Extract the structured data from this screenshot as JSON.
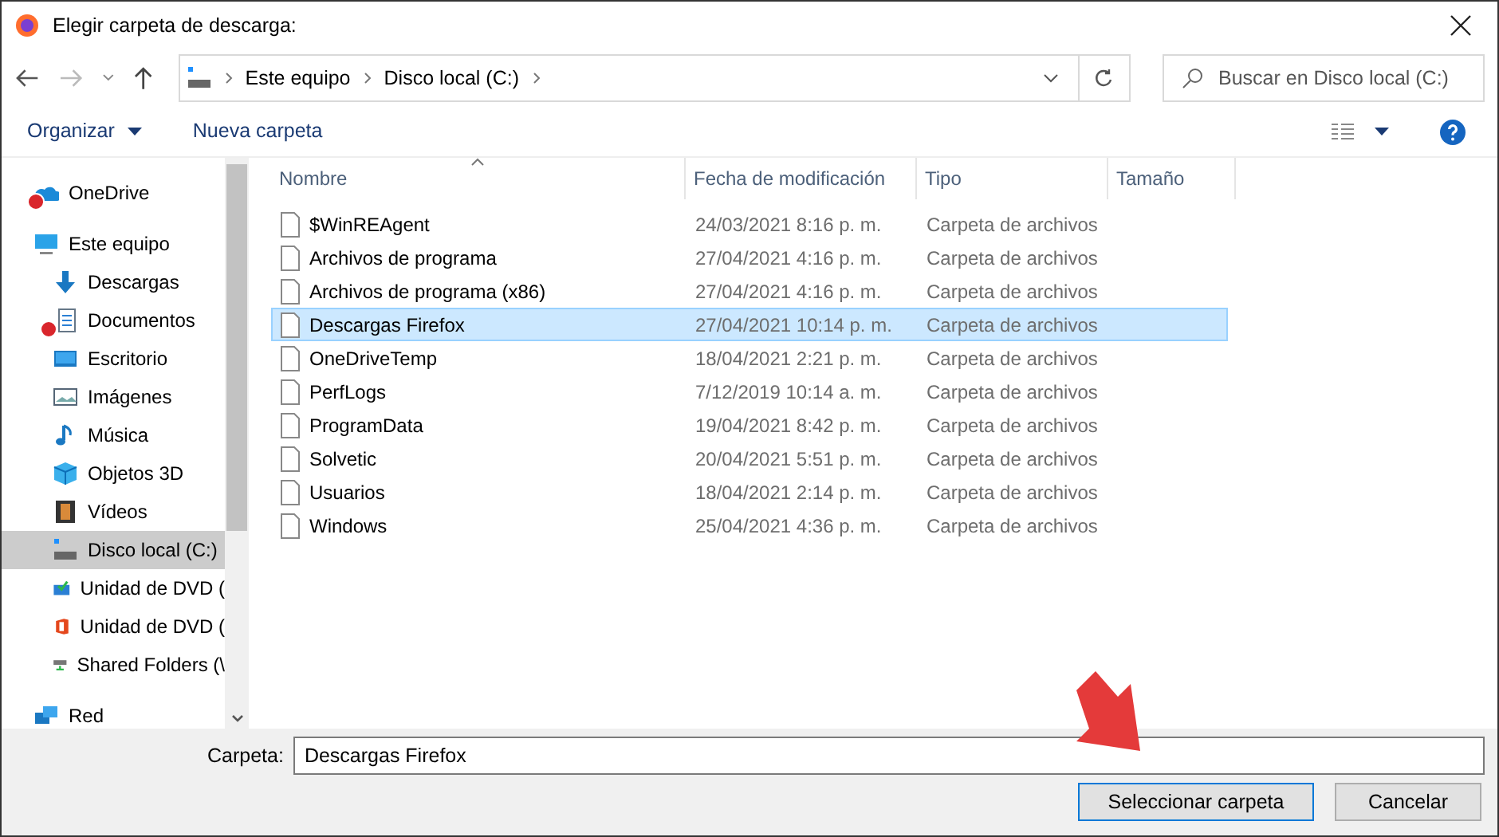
{
  "window": {
    "title": "Elegir carpeta de descarga:"
  },
  "address_bar": {
    "crumbs": [
      "Este equipo",
      "Disco local (C:)"
    ]
  },
  "search": {
    "placeholder": "Buscar en Disco local (C:)"
  },
  "toolbar": {
    "organize": "Organizar",
    "new_folder": "Nueva carpeta"
  },
  "sidebar": {
    "items": [
      {
        "label": "OneDrive",
        "kind": "cloud",
        "error": true,
        "selected": false
      },
      {
        "label": "Este equipo",
        "kind": "pc",
        "error": false,
        "selected": false,
        "children": [
          {
            "label": "Descargas",
            "kind": "download",
            "error": false,
            "selected": false
          },
          {
            "label": "Documentos",
            "kind": "docs",
            "error": true,
            "selected": false
          },
          {
            "label": "Escritorio",
            "kind": "desktop",
            "error": false,
            "selected": false
          },
          {
            "label": "Imágenes",
            "kind": "images",
            "error": false,
            "selected": false
          },
          {
            "label": "Música",
            "kind": "music",
            "error": false,
            "selected": false
          },
          {
            "label": "Objetos 3D",
            "kind": "cube",
            "error": false,
            "selected": false
          },
          {
            "label": "Vídeos",
            "kind": "film",
            "error": false,
            "selected": false
          },
          {
            "label": "Disco local (C:)",
            "kind": "drive",
            "error": false,
            "selected": true
          },
          {
            "label": "Unidad de DVD (",
            "kind": "dvd",
            "error": false,
            "selected": false
          },
          {
            "label": "Unidad de DVD (",
            "kind": "office",
            "error": false,
            "selected": false
          },
          {
            "label": "Shared Folders (\\",
            "kind": "share",
            "error": false,
            "selected": false
          }
        ]
      },
      {
        "label": "Red",
        "kind": "network",
        "error": false,
        "selected": false
      }
    ]
  },
  "table": {
    "columns": [
      "Nombre",
      "Fecha de modificación",
      "Tipo",
      "Tamaño"
    ],
    "rows": [
      {
        "name": "$WinREAgent",
        "date": "24/03/2021 8:16 p. m.",
        "type": "Carpeta de archivos",
        "selected": false
      },
      {
        "name": "Archivos de programa",
        "date": "27/04/2021 4:16 p. m.",
        "type": "Carpeta de archivos",
        "selected": false
      },
      {
        "name": "Archivos de programa (x86)",
        "date": "27/04/2021 4:16 p. m.",
        "type": "Carpeta de archivos",
        "selected": false
      },
      {
        "name": "Descargas Firefox",
        "date": "27/04/2021 10:14 p. m.",
        "type": "Carpeta de archivos",
        "selected": true
      },
      {
        "name": "OneDriveTemp",
        "date": "18/04/2021 2:21 p. m.",
        "type": "Carpeta de archivos",
        "selected": false
      },
      {
        "name": "PerfLogs",
        "date": "7/12/2019 10:14 a. m.",
        "type": "Carpeta de archivos",
        "selected": false
      },
      {
        "name": "ProgramData",
        "date": "19/04/2021 8:42 p. m.",
        "type": "Carpeta de archivos",
        "selected": false
      },
      {
        "name": "Solvetic",
        "date": "20/04/2021 5:51 p. m.",
        "type": "Carpeta de archivos",
        "selected": false
      },
      {
        "name": "Usuarios",
        "date": "18/04/2021 2:14 p. m.",
        "type": "Carpeta de archivos",
        "selected": false
      },
      {
        "name": "Windows",
        "date": "25/04/2021 4:36 p. m.",
        "type": "Carpeta de archivos",
        "selected": false
      }
    ]
  },
  "folder_field": {
    "label": "Carpeta:",
    "value": "Descargas Firefox"
  },
  "buttons": [
    "Seleccionar carpeta",
    "Cancelar"
  ]
}
